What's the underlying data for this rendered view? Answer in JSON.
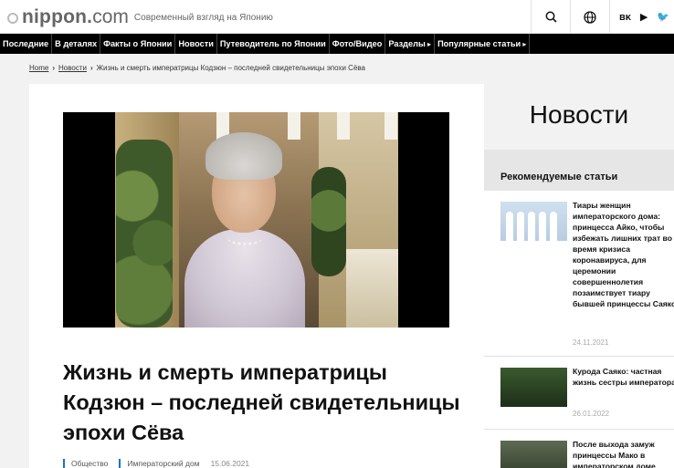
{
  "header": {
    "logo_text": "nippon.",
    "logo_tld": "com",
    "tagline": "Современный взгляд на Японию",
    "icons": [
      "search-icon",
      "globe-icon",
      "vk-icon",
      "youtube-icon",
      "twitter-icon"
    ],
    "social": {
      "vk": "ʙᴋ",
      "youtube": "▶",
      "twitter": "🐦"
    }
  },
  "nav": {
    "items": [
      {
        "label": "Последние"
      },
      {
        "label": "В деталях"
      },
      {
        "label": "Факты о Японии"
      },
      {
        "label": "Новости"
      },
      {
        "label": "Путеводитель по Японии"
      },
      {
        "label": "Фото/Видео"
      },
      {
        "label": "Разделы"
      },
      {
        "label": "Популярные статьи"
      }
    ]
  },
  "breadcrumb": {
    "home": "Home",
    "section": "Новости",
    "current": "Жизнь и смерть императрицы Кодзюн – последней свидетельницы эпохи Сёва"
  },
  "article": {
    "title": "Жизнь и смерть императрицы Кодзюн – последней свидетельницы эпохи Сёва",
    "tags": [
      "Общество",
      "Императорский дом"
    ],
    "date": "15.06.2021"
  },
  "sidebar": {
    "section_title": "Новости",
    "recommended_heading": "Рекомендуемые статьи",
    "items": [
      {
        "title": "Тиары женщин императорского дома: принцесса Айко, чтобы избежать лишних трат во время кризиса коронавируса, для церемонии совершеннолетия позаимствует тиару бывшей принцессы Саяко",
        "date": "24.11.2021"
      },
      {
        "title": "Курода Саяко: частная жизнь сестры императора",
        "date": "26.01.2022"
      },
      {
        "title": "После выхода замуж принцессы Мако в императорском доме",
        "date": ""
      }
    ]
  },
  "colors": {
    "nav_bg": "#000000",
    "tag_accent": "#1a73c9"
  }
}
